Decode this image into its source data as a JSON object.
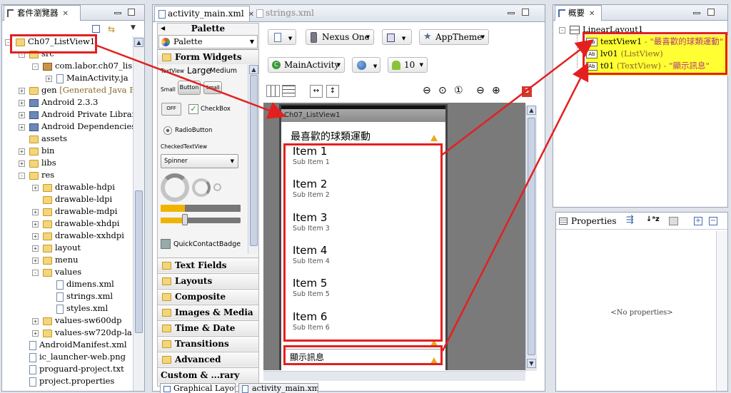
{
  "package_explorer": {
    "tab_title": "套件瀏覽器",
    "rows": [
      {
        "label": "Ch07_ListView1",
        "indent": 0,
        "exp": "-",
        "icon": "project"
      },
      {
        "label": "src",
        "indent": 1,
        "exp": "-",
        "icon": "folder"
      },
      {
        "label": "com.labor.ch07_lis",
        "indent": 2,
        "exp": "-",
        "icon": "pkg"
      },
      {
        "label": "MainActivity.ja",
        "indent": 3,
        "exp": "+",
        "icon": "file"
      },
      {
        "label": "gen",
        "indent": 1,
        "exp": "+",
        "icon": "folder",
        "suffix": " [Generated Java Fi"
      },
      {
        "label": "Android 2.3.3",
        "indent": 1,
        "exp": "+",
        "icon": "lib"
      },
      {
        "label": "Android Private Librar",
        "indent": 1,
        "exp": "+",
        "icon": "lib"
      },
      {
        "label": "Android Dependencies",
        "indent": 1,
        "exp": "+",
        "icon": "lib"
      },
      {
        "label": "assets",
        "indent": 1,
        "exp": "",
        "icon": "folder"
      },
      {
        "label": "bin",
        "indent": 1,
        "exp": "+",
        "icon": "folder"
      },
      {
        "label": "libs",
        "indent": 1,
        "exp": "+",
        "icon": "folder"
      },
      {
        "label": "res",
        "indent": 1,
        "exp": "-",
        "icon": "folder"
      },
      {
        "label": "drawable-hdpi",
        "indent": 2,
        "exp": "+",
        "icon": "folder"
      },
      {
        "label": "drawable-ldpi",
        "indent": 2,
        "exp": "",
        "icon": "folder"
      },
      {
        "label": "drawable-mdpi",
        "indent": 2,
        "exp": "+",
        "icon": "folder"
      },
      {
        "label": "drawable-xhdpi",
        "indent": 2,
        "exp": "+",
        "icon": "folder"
      },
      {
        "label": "drawable-xxhdpi",
        "indent": 2,
        "exp": "+",
        "icon": "folder"
      },
      {
        "label": "layout",
        "indent": 2,
        "exp": "+",
        "icon": "folder"
      },
      {
        "label": "menu",
        "indent": 2,
        "exp": "+",
        "icon": "folder"
      },
      {
        "label": "values",
        "indent": 2,
        "exp": "-",
        "icon": "folder"
      },
      {
        "label": "dimens.xml",
        "indent": 3,
        "exp": "",
        "icon": "file"
      },
      {
        "label": "strings.xml",
        "indent": 3,
        "exp": "",
        "icon": "file"
      },
      {
        "label": "styles.xml",
        "indent": 3,
        "exp": "",
        "icon": "file"
      },
      {
        "label": "values-sw600dp",
        "indent": 2,
        "exp": "+",
        "icon": "folder"
      },
      {
        "label": "values-sw720dp-la",
        "indent": 2,
        "exp": "+",
        "icon": "folder"
      },
      {
        "label": "AndroidManifest.xml",
        "indent": 1,
        "exp": "",
        "icon": "file"
      },
      {
        "label": "ic_launcher-web.png",
        "indent": 1,
        "exp": "",
        "icon": "file"
      },
      {
        "label": "proguard-project.txt",
        "indent": 1,
        "exp": "",
        "icon": "file"
      },
      {
        "label": "project.properties",
        "indent": 1,
        "exp": "",
        "icon": "file"
      }
    ]
  },
  "editor": {
    "tabs": [
      "activity_main.xml",
      "strings.xml"
    ],
    "palette_title": "Palette",
    "palette_selector": "Palette",
    "categories_top": [
      "Form Widgets"
    ],
    "widget_labels": {
      "textview": "TextView",
      "large": "Large",
      "medium": "Medium",
      "small": "Small",
      "button": "Button",
      "small_button": "Small",
      "toggle": "OFF",
      "checkbox": "CheckBox",
      "radio": "RadioButton",
      "checked_tv": "CheckedTextView",
      "spinner": "Spinner",
      "quick_contact": "QuickContactBadge"
    },
    "categories": [
      "Text Fields",
      "Layouts",
      "Composite",
      "Images & Media",
      "Time & Date",
      "Transitions",
      "Advanced",
      "Custom & ...rary Views"
    ],
    "toolbar": {
      "device": "Nexus One",
      "theme": "AppTheme",
      "activity": "MainActivity",
      "api": "10",
      "error_count": "3"
    },
    "bottom_tabs": [
      "Graphical Layout",
      "activity_main.xml"
    ],
    "device_screen": {
      "title_bar": "Ch07_ListView1",
      "header_text": "最喜歡的球類運動",
      "items": [
        {
          "title": "Item 1",
          "sub": "Sub Item 1"
        },
        {
          "title": "Item 2",
          "sub": "Sub Item 2"
        },
        {
          "title": "Item 3",
          "sub": "Sub Item 3"
        },
        {
          "title": "Item 4",
          "sub": "Sub Item 4"
        },
        {
          "title": "Item 5",
          "sub": "Sub Item 5"
        },
        {
          "title": "Item 6",
          "sub": "Sub Item 6"
        }
      ],
      "footer_text": "顯示訊息"
    }
  },
  "outline": {
    "tab_title": "概要",
    "root": "LinearLayout1",
    "children": [
      {
        "id": "textView1",
        "type": " - ",
        "value": "\"最喜歡的球類運動\""
      },
      {
        "id": "lv01",
        "type": " (ListView)",
        "value": ""
      },
      {
        "id": "t01",
        "type": " (TextView) - ",
        "value": "\"顯示訊息\""
      }
    ]
  },
  "properties": {
    "title": "Properties",
    "empty": "<No properties>"
  },
  "colors": {
    "highlight": "#ffff33",
    "annotation_red": "#e32020"
  }
}
